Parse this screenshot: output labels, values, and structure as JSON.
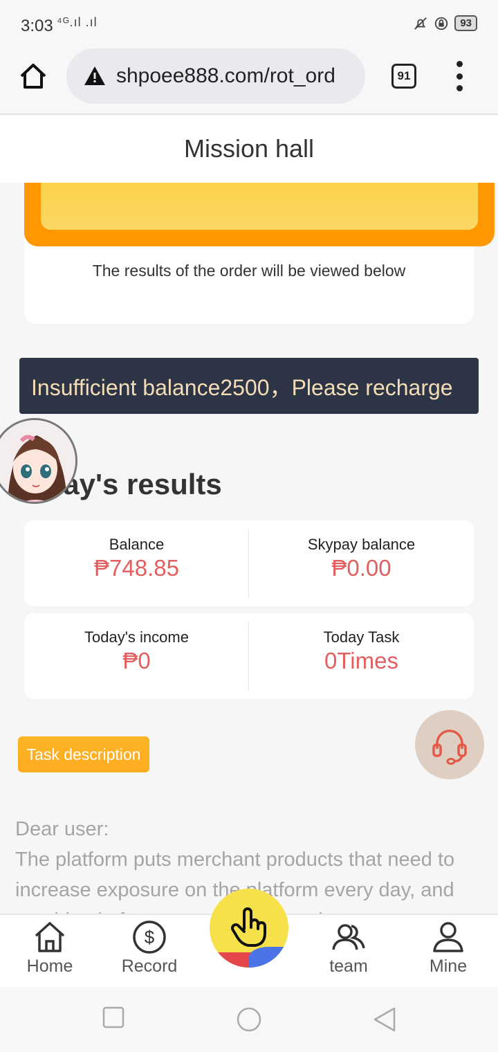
{
  "status_bar": {
    "time": "3:03",
    "signal": "⁴ᴳ.ıl .ıl",
    "battery": "93"
  },
  "browser": {
    "url": "shpoee888.com/rot_ord",
    "tab_count": "91"
  },
  "header": {
    "title": "Mission hall"
  },
  "order_card": {
    "note": "The results of the order will be viewed below"
  },
  "alert": {
    "text": "Insufficient balance2500，Please recharge"
  },
  "today": {
    "title": "oday's results",
    "balance_label": "Balance",
    "balance_value": "₱748.85",
    "skypay_label": "Skypay balance",
    "skypay_value": "₱0.00",
    "income_label": "Today's income",
    "income_value": "₱0",
    "task_label": "Today Task",
    "task_value": "0Times"
  },
  "task_button": {
    "label": "Task description"
  },
  "description": {
    "greeting": "Dear user:",
    "body": "The platform puts merchant products that need to increase exposure on the platform every day, and provide platform users to order orders to"
  },
  "bottom_nav": {
    "home": "Home",
    "record": "Record",
    "team": "team",
    "mine": "Mine"
  },
  "icons": {
    "home": "home-icon",
    "warning": "warning-icon",
    "record": "dollar-circle-icon",
    "center": "hand-tap-icon",
    "team": "team-icon",
    "mine": "user-icon",
    "support": "headset-icon"
  },
  "colors": {
    "accent_orange": "#ff9800",
    "alert_bg": "#2c3446",
    "alert_text": "#f4dcb6",
    "value_red": "#e35e5e"
  }
}
